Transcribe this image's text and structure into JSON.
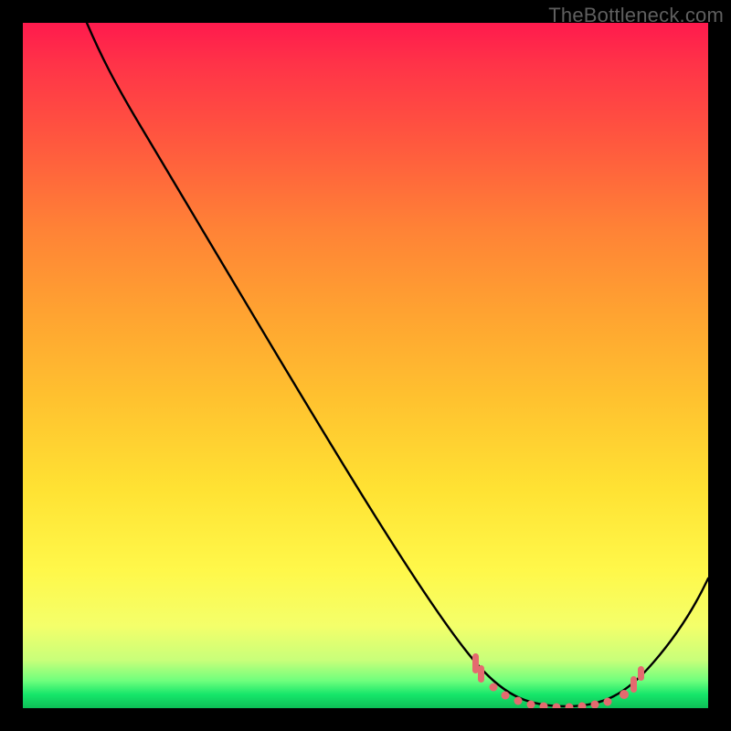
{
  "watermark": "TheBottleneck.com",
  "chart_data": {
    "type": "line",
    "title": "",
    "xlabel": "",
    "ylabel": "",
    "xlim": [
      0,
      100
    ],
    "ylim": [
      0,
      100
    ],
    "grid": false,
    "series": [
      {
        "name": "curve",
        "x": [
          9,
          13,
          20,
          30,
          40,
          50,
          60,
          65,
          70,
          75,
          80,
          85,
          90,
          100
        ],
        "y": [
          100,
          96,
          86,
          72,
          57,
          43,
          28,
          20,
          12,
          6,
          3,
          3,
          8,
          28
        ]
      }
    ],
    "highlight_points": {
      "name": "recommended-range",
      "x": [
        65,
        68,
        70,
        72,
        74,
        76,
        78,
        80,
        82,
        84,
        86,
        88,
        90
      ],
      "y": [
        20,
        14,
        12,
        9,
        7,
        5,
        4,
        3,
        3,
        3,
        3,
        5,
        8
      ]
    }
  }
}
